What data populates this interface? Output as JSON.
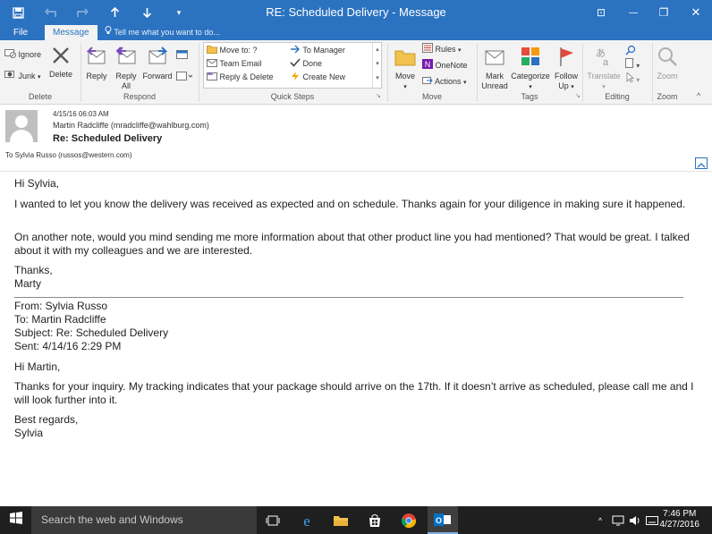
{
  "window": {
    "title": "RE: Scheduled Delivery - Message",
    "controls": {
      "ribbon_display": "⊡",
      "minimize": "—",
      "restore": "❐",
      "close": "✕"
    }
  },
  "tabs": {
    "file": "File",
    "message": "Message",
    "tell_me": "Tell me what you want to do..."
  },
  "ribbon": {
    "delete_group": {
      "ignore": "Ignore",
      "junk": "Junk",
      "delete": "Delete",
      "label": "Delete"
    },
    "respond_group": {
      "reply": "Reply",
      "reply_all_1": "Reply",
      "reply_all_2": "All",
      "forward": "Forward",
      "label": "Respond"
    },
    "quick_steps": {
      "items": [
        "Move to: ?",
        "Team Email",
        "Reply & Delete",
        "To Manager",
        "Done",
        "Create New"
      ],
      "label": "Quick Steps"
    },
    "move_group": {
      "move": "Move",
      "rules": "Rules",
      "onenote": "OneNote",
      "actions": "Actions",
      "label": "Move"
    },
    "tags_group": {
      "mark_unread_1": "Mark",
      "mark_unread_2": "Unread",
      "categorize": "Categorize",
      "follow_up_1": "Follow",
      "follow_up_2": "Up",
      "label": "Tags"
    },
    "editing_group": {
      "translate": "Translate",
      "label": "Editing"
    },
    "zoom_group": {
      "zoom": "Zoom",
      "label": "Zoom"
    }
  },
  "header": {
    "date": "4/15/16  06:03 AM",
    "from": "Martin Radcliffe (mradcliffe@wahlburg.com)",
    "subject": "Re: Scheduled Delivery",
    "to": "To  Sylvia Russo (russos@western.com)"
  },
  "body": {
    "greeting": "Hi Sylvia,",
    "p1": "I wanted to let you know the delivery was received as expected and on schedule. Thanks again for your diligence in making sure it happened.",
    "p2": "On another note, would you mind sending me more information about that other product line you had mentioned? That would be great. I talked about it with my colleagues and we are interested.",
    "closing1": "Thanks,",
    "closing2": "Marty",
    "quoted": {
      "from": "From: Sylvia Russo",
      "to": "To: Martin Radcliffe",
      "subject": "Subject: Re: Scheduled Delivery",
      "sent": "Sent: 4/14/16 2:29 PM",
      "greeting": "Hi Martin,",
      "p1": "Thanks for your inquiry. My tracking indicates that your package should arrive on the 17th. If it doesn’t arrive as scheduled, please call me and I will look further into it.",
      "closing1": "Best regards,",
      "closing2": "Sylvia"
    }
  },
  "taskbar": {
    "search_placeholder": "Search the web and Windows",
    "time": "7:46 PM",
    "date": "4/27/2016"
  },
  "colors": {
    "accent": "#2b72c0",
    "taskbar": "#1f1f1f"
  }
}
